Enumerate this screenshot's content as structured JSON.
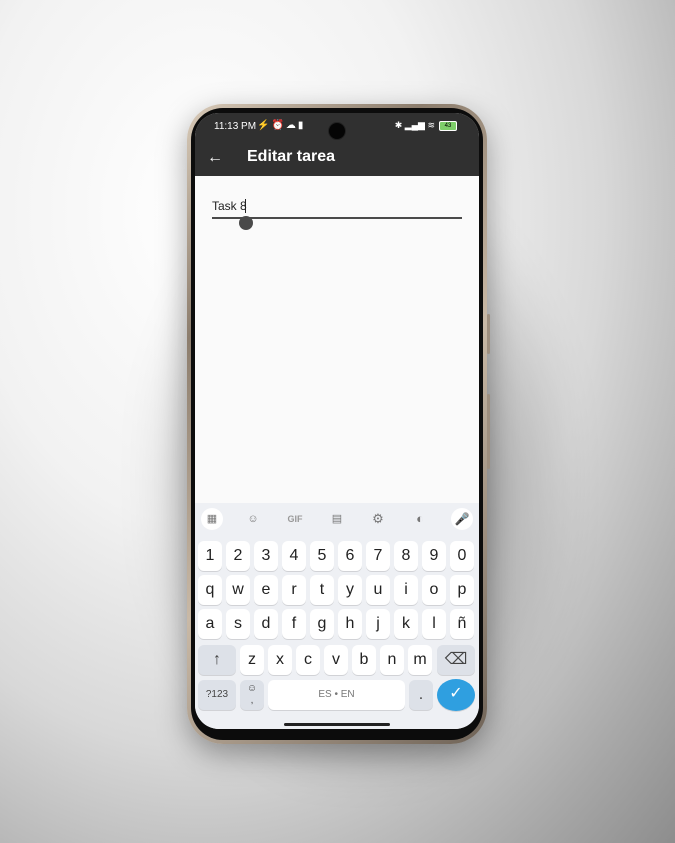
{
  "status": {
    "time": "11:13 PM",
    "left_icons": "⚡⏰☁▮",
    "right_icons": "✱ ▂▄▆ ≋",
    "battery": "43"
  },
  "appbar": {
    "back_icon": "←",
    "title": "Editar tarea"
  },
  "task": {
    "value": "Task 8"
  },
  "keyboard": {
    "toolbar": {
      "grid_icon": "▦",
      "sticker_icon": "☺",
      "gif_label": "GIF",
      "clipboard_icon": "▤",
      "settings_icon": "⚙",
      "palette_icon": "◐",
      "mic_icon": "🎤"
    },
    "row_numbers": [
      "1",
      "2",
      "3",
      "4",
      "5",
      "6",
      "7",
      "8",
      "9",
      "0"
    ],
    "row1": [
      "q",
      "w",
      "e",
      "r",
      "t",
      "y",
      "u",
      "i",
      "o",
      "p"
    ],
    "row2": [
      "a",
      "s",
      "d",
      "f",
      "g",
      "h",
      "j",
      "k",
      "l",
      "ñ"
    ],
    "row3": [
      "z",
      "x",
      "c",
      "v",
      "b",
      "n",
      "m"
    ],
    "shift_icon": "↑",
    "backspace_icon": "⌫",
    "symbols_label": "?123",
    "emoji_label": "☺\n,",
    "space_label": "ES • EN",
    "period_label": ".",
    "enter_icon": "✓"
  }
}
